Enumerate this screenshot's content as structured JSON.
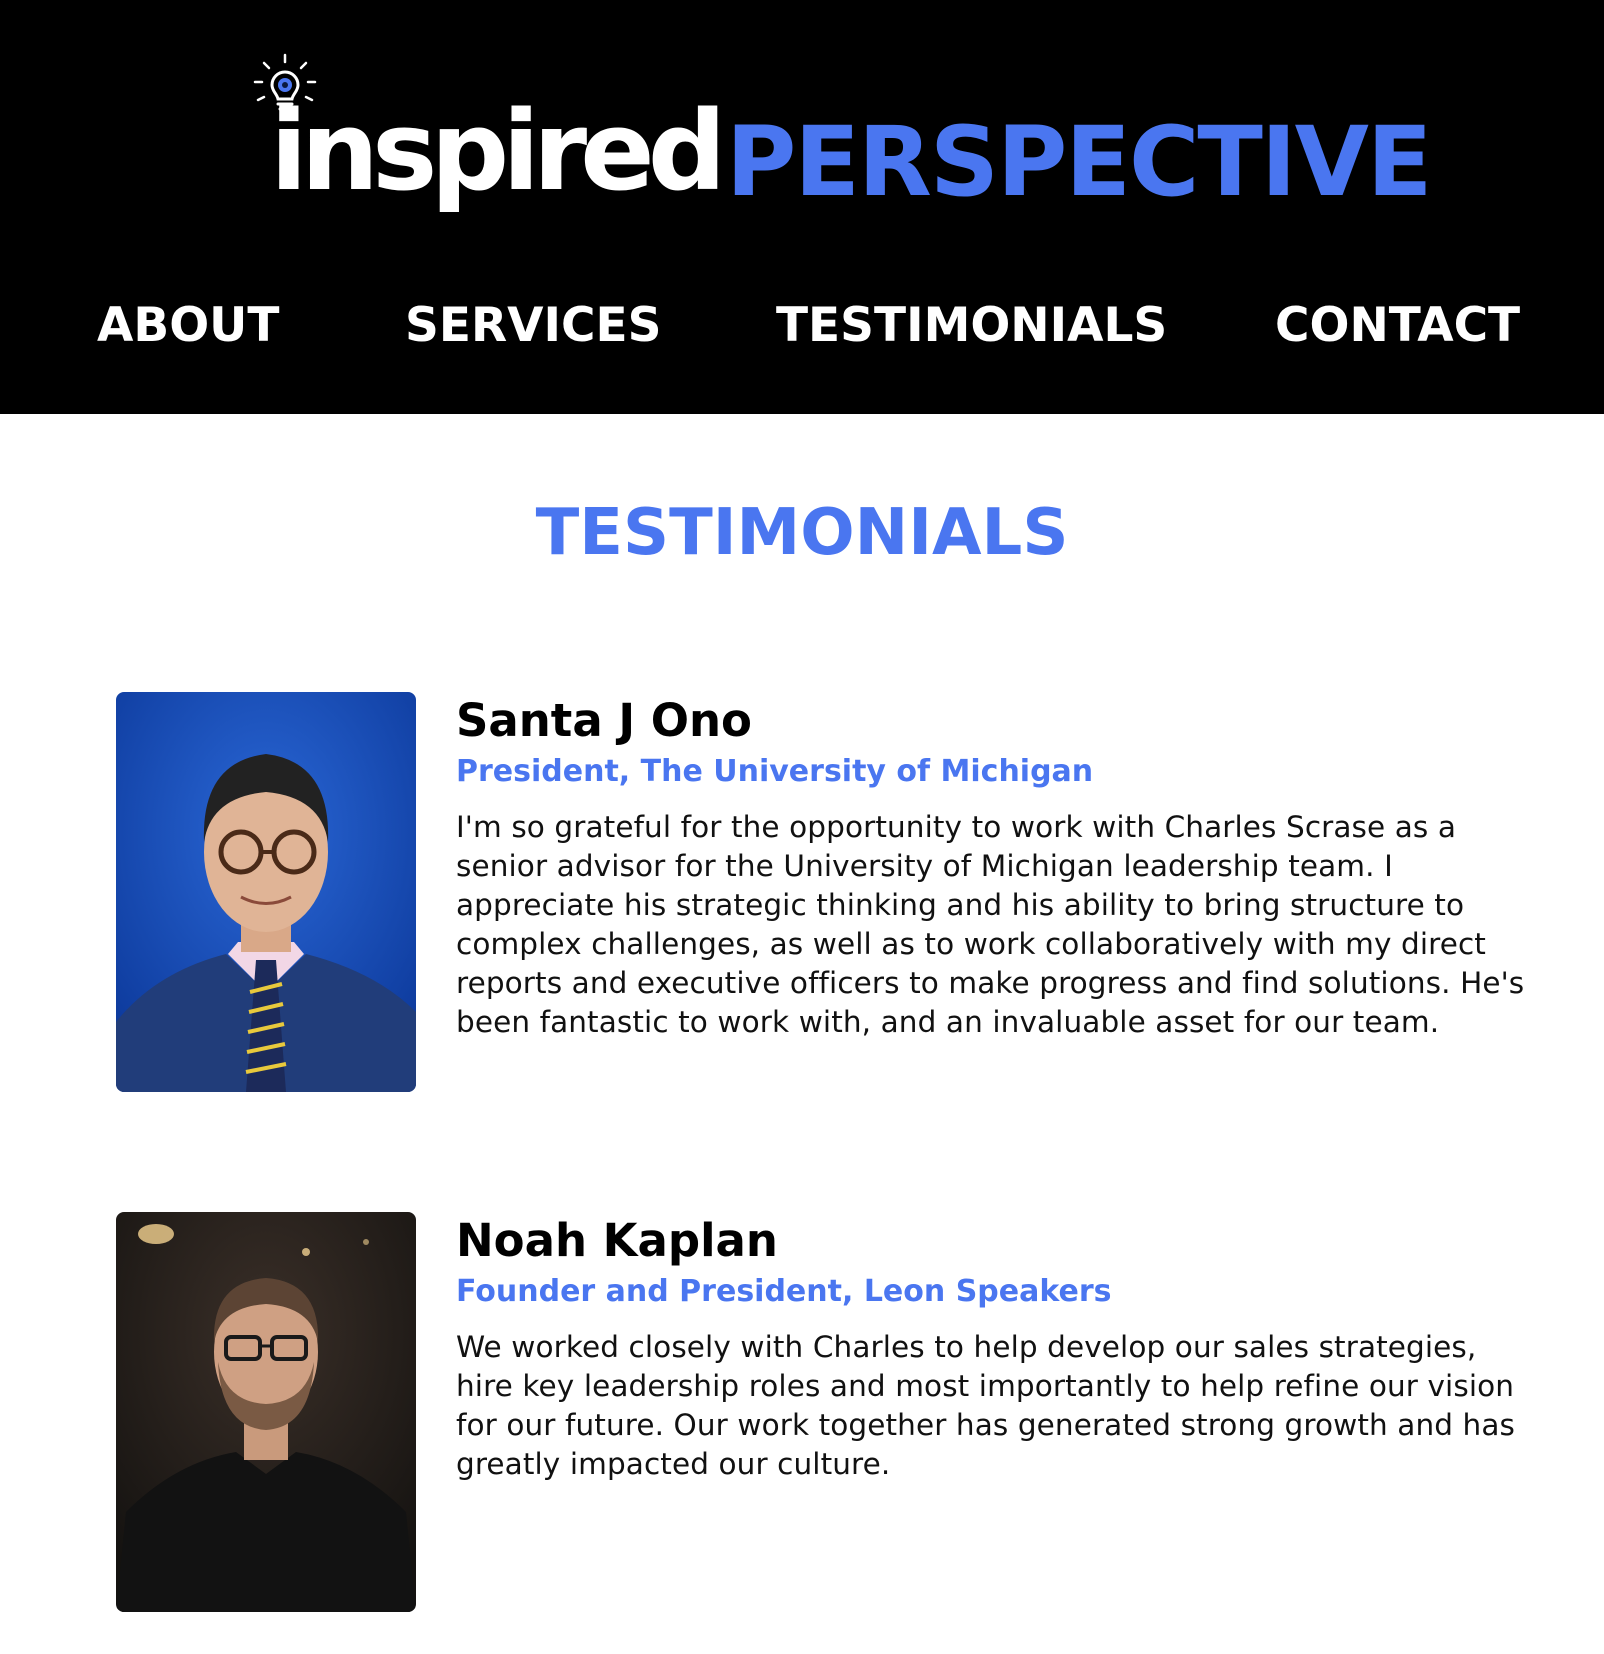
{
  "brand": {
    "logo_word_1": "inspired",
    "logo_word_2": "PERSPECTIVE",
    "logo_icon": "lightbulb-eye-icon",
    "accent_color": "#4a76f0",
    "header_bg": "#000000"
  },
  "nav": {
    "items": [
      {
        "label": "ABOUT"
      },
      {
        "label": "SERVICES"
      },
      {
        "label": "TESTIMONIALS"
      },
      {
        "label": "CONTACT"
      }
    ]
  },
  "main": {
    "section_title": "TESTIMONIALS",
    "testimonials": [
      {
        "name": "Santa J Ono",
        "role": "President, The University of Michigan",
        "quote": "I'm so grateful for the opportunity to work with Charles Scrase as a senior advisor for the University of Michigan leadership team. I appreciate his strategic thinking and his ability to bring structure to complex challenges, as well as to work collaboratively with my direct reports and executive officers to make progress and find solutions. He's been fantastic to work with, and an invaluable asset for our team."
      },
      {
        "name": "Noah Kaplan",
        "role": "Founder and President, Leon Speakers",
        "quote": "We worked closely with Charles to help develop our sales strategies, hire key leadership roles and most importantly to help refine our vision for our future. Our work together has generated strong growth and has greatly impacted our culture."
      }
    ]
  }
}
